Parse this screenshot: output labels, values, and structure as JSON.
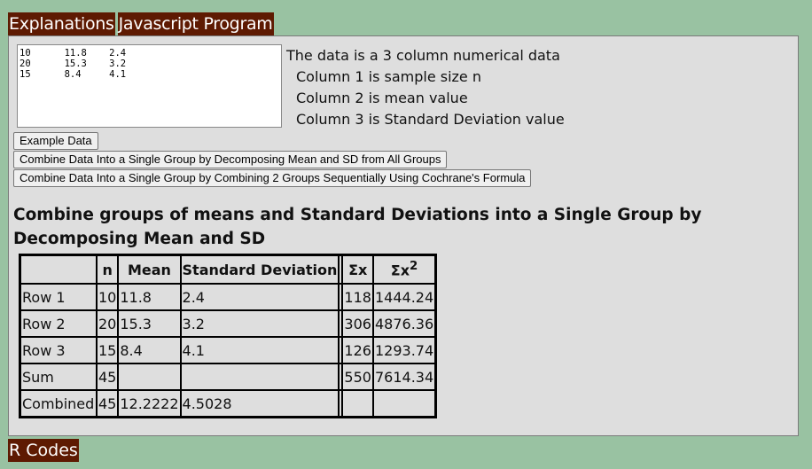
{
  "tabs": {
    "explanations": "Explanations",
    "program": "Javascript Program",
    "rcodes": "R Codes"
  },
  "input": {
    "text": "10\t11.8\t2.4\n20\t15.3\t3.2\n15\t8.4\t4.1"
  },
  "explanation": {
    "line1": "The data is a 3 column numerical data",
    "line2": "Column 1 is sample size n",
    "line3": "Column 2 is mean value",
    "line4": "Column 3 is Standard Deviation value"
  },
  "buttons": {
    "example": "Example Data",
    "decompose": "Combine Data Into a Single Group by Decomposing Mean and SD from All Groups",
    "cochrane": "Combine Data Into a Single Group by Combining 2 Groups Sequentially Using Cochrane's Formula"
  },
  "result": {
    "title": "Combine groups of means and Standard Deviations into a Single Group by Decomposing Mean and SD",
    "headers": {
      "n": "n",
      "mean": "Mean",
      "sd": "Standard Deviation",
      "sx": "Σx",
      "sx2": "Σx",
      "sup": "2"
    },
    "rows": [
      {
        "label": "Row 1",
        "n": "10",
        "mean": "11.8",
        "sd": "2.4",
        "sx": "118",
        "sx2": "1444.24"
      },
      {
        "label": "Row 2",
        "n": "20",
        "mean": "15.3",
        "sd": "3.2",
        "sx": "306",
        "sx2": "4876.36"
      },
      {
        "label": "Row 3",
        "n": "15",
        "mean": "8.4",
        "sd": "4.1",
        "sx": "126",
        "sx2": "1293.74"
      },
      {
        "label": "Sum",
        "n": "45",
        "mean": "",
        "sd": "",
        "sx": "550",
        "sx2": "7614.34"
      },
      {
        "label": "Combined",
        "n": "45",
        "mean": "12.2222",
        "sd": "4.5028",
        "sx": "",
        "sx2": ""
      }
    ]
  }
}
